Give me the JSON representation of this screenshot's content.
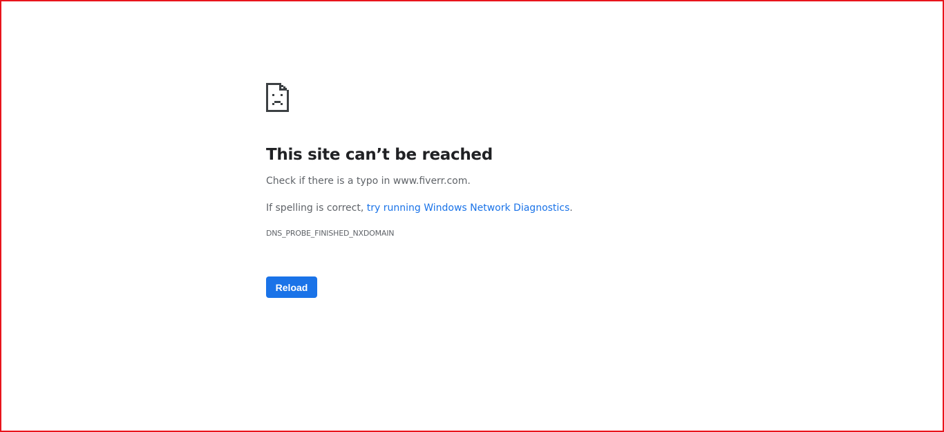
{
  "error_page": {
    "icon": "sad-document-icon",
    "heading": "This site can’t be reached",
    "message_1": "Check if there is a typo in www.fiverr.com.",
    "message_2_prefix": "If spelling is correct, ",
    "diagnostics_link": "try running Windows Network Diagnostics",
    "message_2_suffix": ".",
    "error_code": "DNS_PROBE_FINISHED_NXDOMAIN",
    "reload_label": "Reload"
  },
  "colors": {
    "frame_border": "#e8141c",
    "heading": "#202124",
    "body_text": "#5f6368",
    "link": "#1a73e8",
    "button_bg": "#1a73e8",
    "button_text": "#ffffff"
  }
}
